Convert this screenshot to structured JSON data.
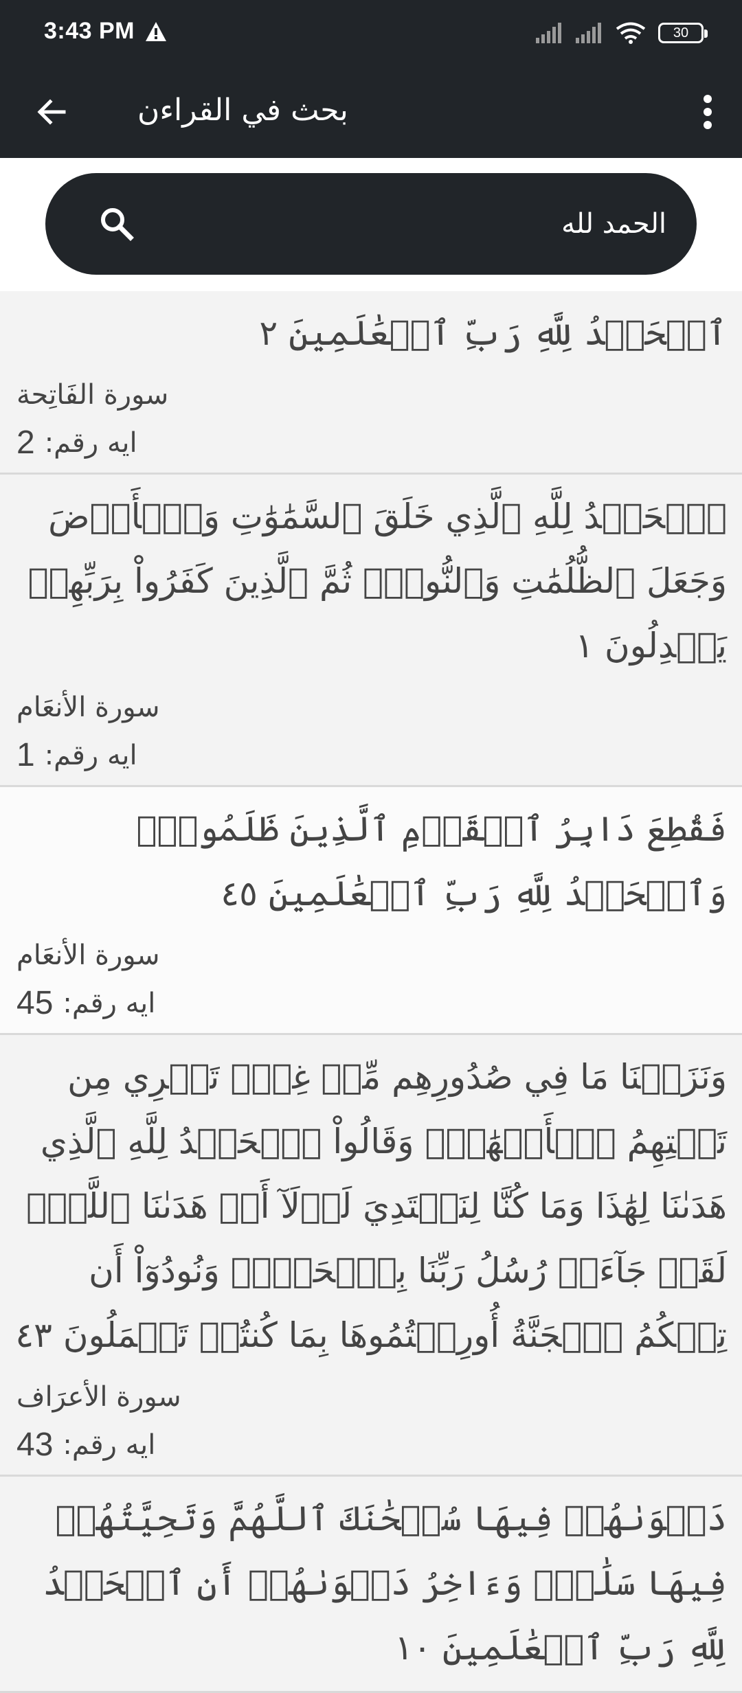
{
  "status_bar": {
    "time": "3:43 PM",
    "battery": "30"
  },
  "app_bar": {
    "title": "بحث في القراءن"
  },
  "search": {
    "value": "الحمد لله"
  },
  "ayah_label": "ايه رقم:",
  "results": [
    {
      "text": "ٱلۡحَمۡدُ لِلَّهِ رَبِّ ٱلۡعَٰلَمِينَ ٢",
      "surah": "سورة الفَاتِحة",
      "number": "2"
    },
    {
      "text": "ٱلۡحَمۡدُ لِلَّهِ ٱلَّذِي خَلَقَ ٱلسَّمَٰوَٰتِ وَٱلۡأَرۡضَ وَجَعَلَ ٱلظُّلُمَٰتِ وَٱلنُّورَۖ ثُمَّ ٱلَّذِينَ كَفَرُواْ بِرَبِّهِمۡ يَعۡدِلُونَ ١",
      "surah": "سورة الأنعَام",
      "number": "1"
    },
    {
      "text": "فَقُطِعَ دَابِرُ ٱلۡقَوۡمِ ٱلَّذِينَ ظَلَمُواْۚ وَٱلۡحَمۡدُ لِلَّهِ رَبِّ ٱلۡعَٰلَمِينَ ٤٥",
      "surah": "سورة الأنعَام",
      "number": "45"
    },
    {
      "text": "وَنَزَعۡنَا مَا فِي صُدُورِهِم مِّنۡ غِلّٖ تَجۡرِي مِن تَحۡتِهِمُ ٱلۡأَنۡهَٰرُۖ وَقَالُواْ ٱلۡحَمۡدُ لِلَّهِ ٱلَّذِي هَدَىٰنَا لِهَٰذَا وَمَا كُنَّا لِنَهۡتَدِيَ لَوۡلَآ أَنۡ هَدَىٰنَا ٱللَّهُۖ لَقَدۡ جَآءَتۡ رُسُلُ رَبِّنَا بِٱلۡحَقِّۖ وَنُودُوٓاْ أَن تِلۡكُمُ ٱلۡجَنَّةُ أُورِثۡتُمُوهَا بِمَا كُنتُمۡ تَعۡمَلُونَ ٤٣",
      "surah": "سورة الأعرَاف",
      "number": "43"
    },
    {
      "text": "دَعۡوَىٰهُمۡ فِيهَا سُبۡحَٰنَكَ ٱللَّهُمَّ وَتَحِيَّتُهُمۡ فِيهَا سَلَٰمٞۚ وَءَاخِرُ دَعۡوَىٰهُمۡ أَنِ ٱلۡحَمۡدُ لِلَّهِ رَبِّ ٱلۡعَٰلَمِينَ ١٠",
      "surah": "",
      "number": ""
    }
  ]
}
